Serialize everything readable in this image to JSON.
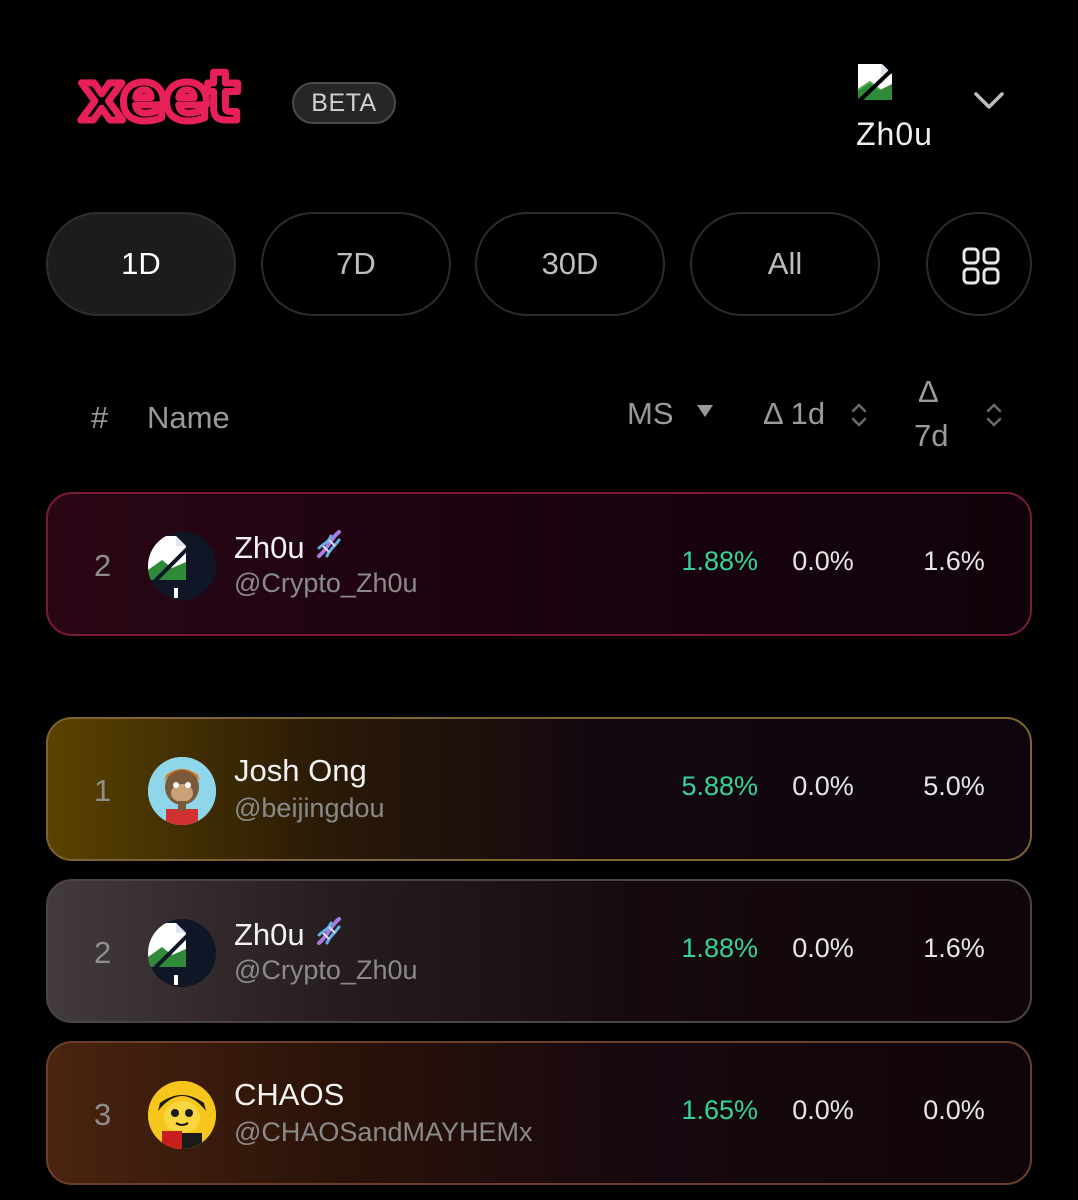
{
  "header": {
    "brand_logo_text": "xeet",
    "beta_label": "BETA",
    "profile_name": "Zh0u",
    "profile_image_icon": "broken-image-icon",
    "menu_icon": "chevron-down-icon"
  },
  "filters": {
    "tabs": [
      {
        "label": "1D",
        "active": true
      },
      {
        "label": "7D",
        "active": false
      },
      {
        "label": "30D",
        "active": false
      },
      {
        "label": "All",
        "active": false
      }
    ],
    "view_toggle_icon": "grid-icon"
  },
  "table": {
    "columns": {
      "rank": "#",
      "name": "Name",
      "ms": "MS",
      "delta_1d": "Δ 1d",
      "delta_7d_top": "Δ",
      "delta_7d_bottom": "7d"
    },
    "pinned_row": {
      "rank": "2",
      "name": "Zh0u",
      "handle": "@Crypto_Zh0u",
      "ms": "1.88%",
      "delta_1d": "0.0%",
      "delta_7d": "1.6%",
      "badge_icon": "dna-icon"
    },
    "rows": [
      {
        "rank": "1",
        "name": "Josh Ong",
        "handle": "@beijingdou",
        "ms": "5.88%",
        "delta_1d": "0.0%",
        "delta_7d": "5.0%"
      },
      {
        "rank": "2",
        "name": "Zh0u",
        "handle": "@Crypto_Zh0u",
        "ms": "1.88%",
        "delta_1d": "0.0%",
        "delta_7d": "1.6%",
        "badge_icon": "dna-icon"
      },
      {
        "rank": "3",
        "name": "CHAOS",
        "handle": "@CHAOSandMAYHEMx",
        "ms": "1.65%",
        "delta_1d": "0.0%",
        "delta_7d": "0.0%"
      }
    ]
  },
  "colors": {
    "brand": "#e8205a",
    "positive": "#34d399",
    "background": "#000000"
  }
}
